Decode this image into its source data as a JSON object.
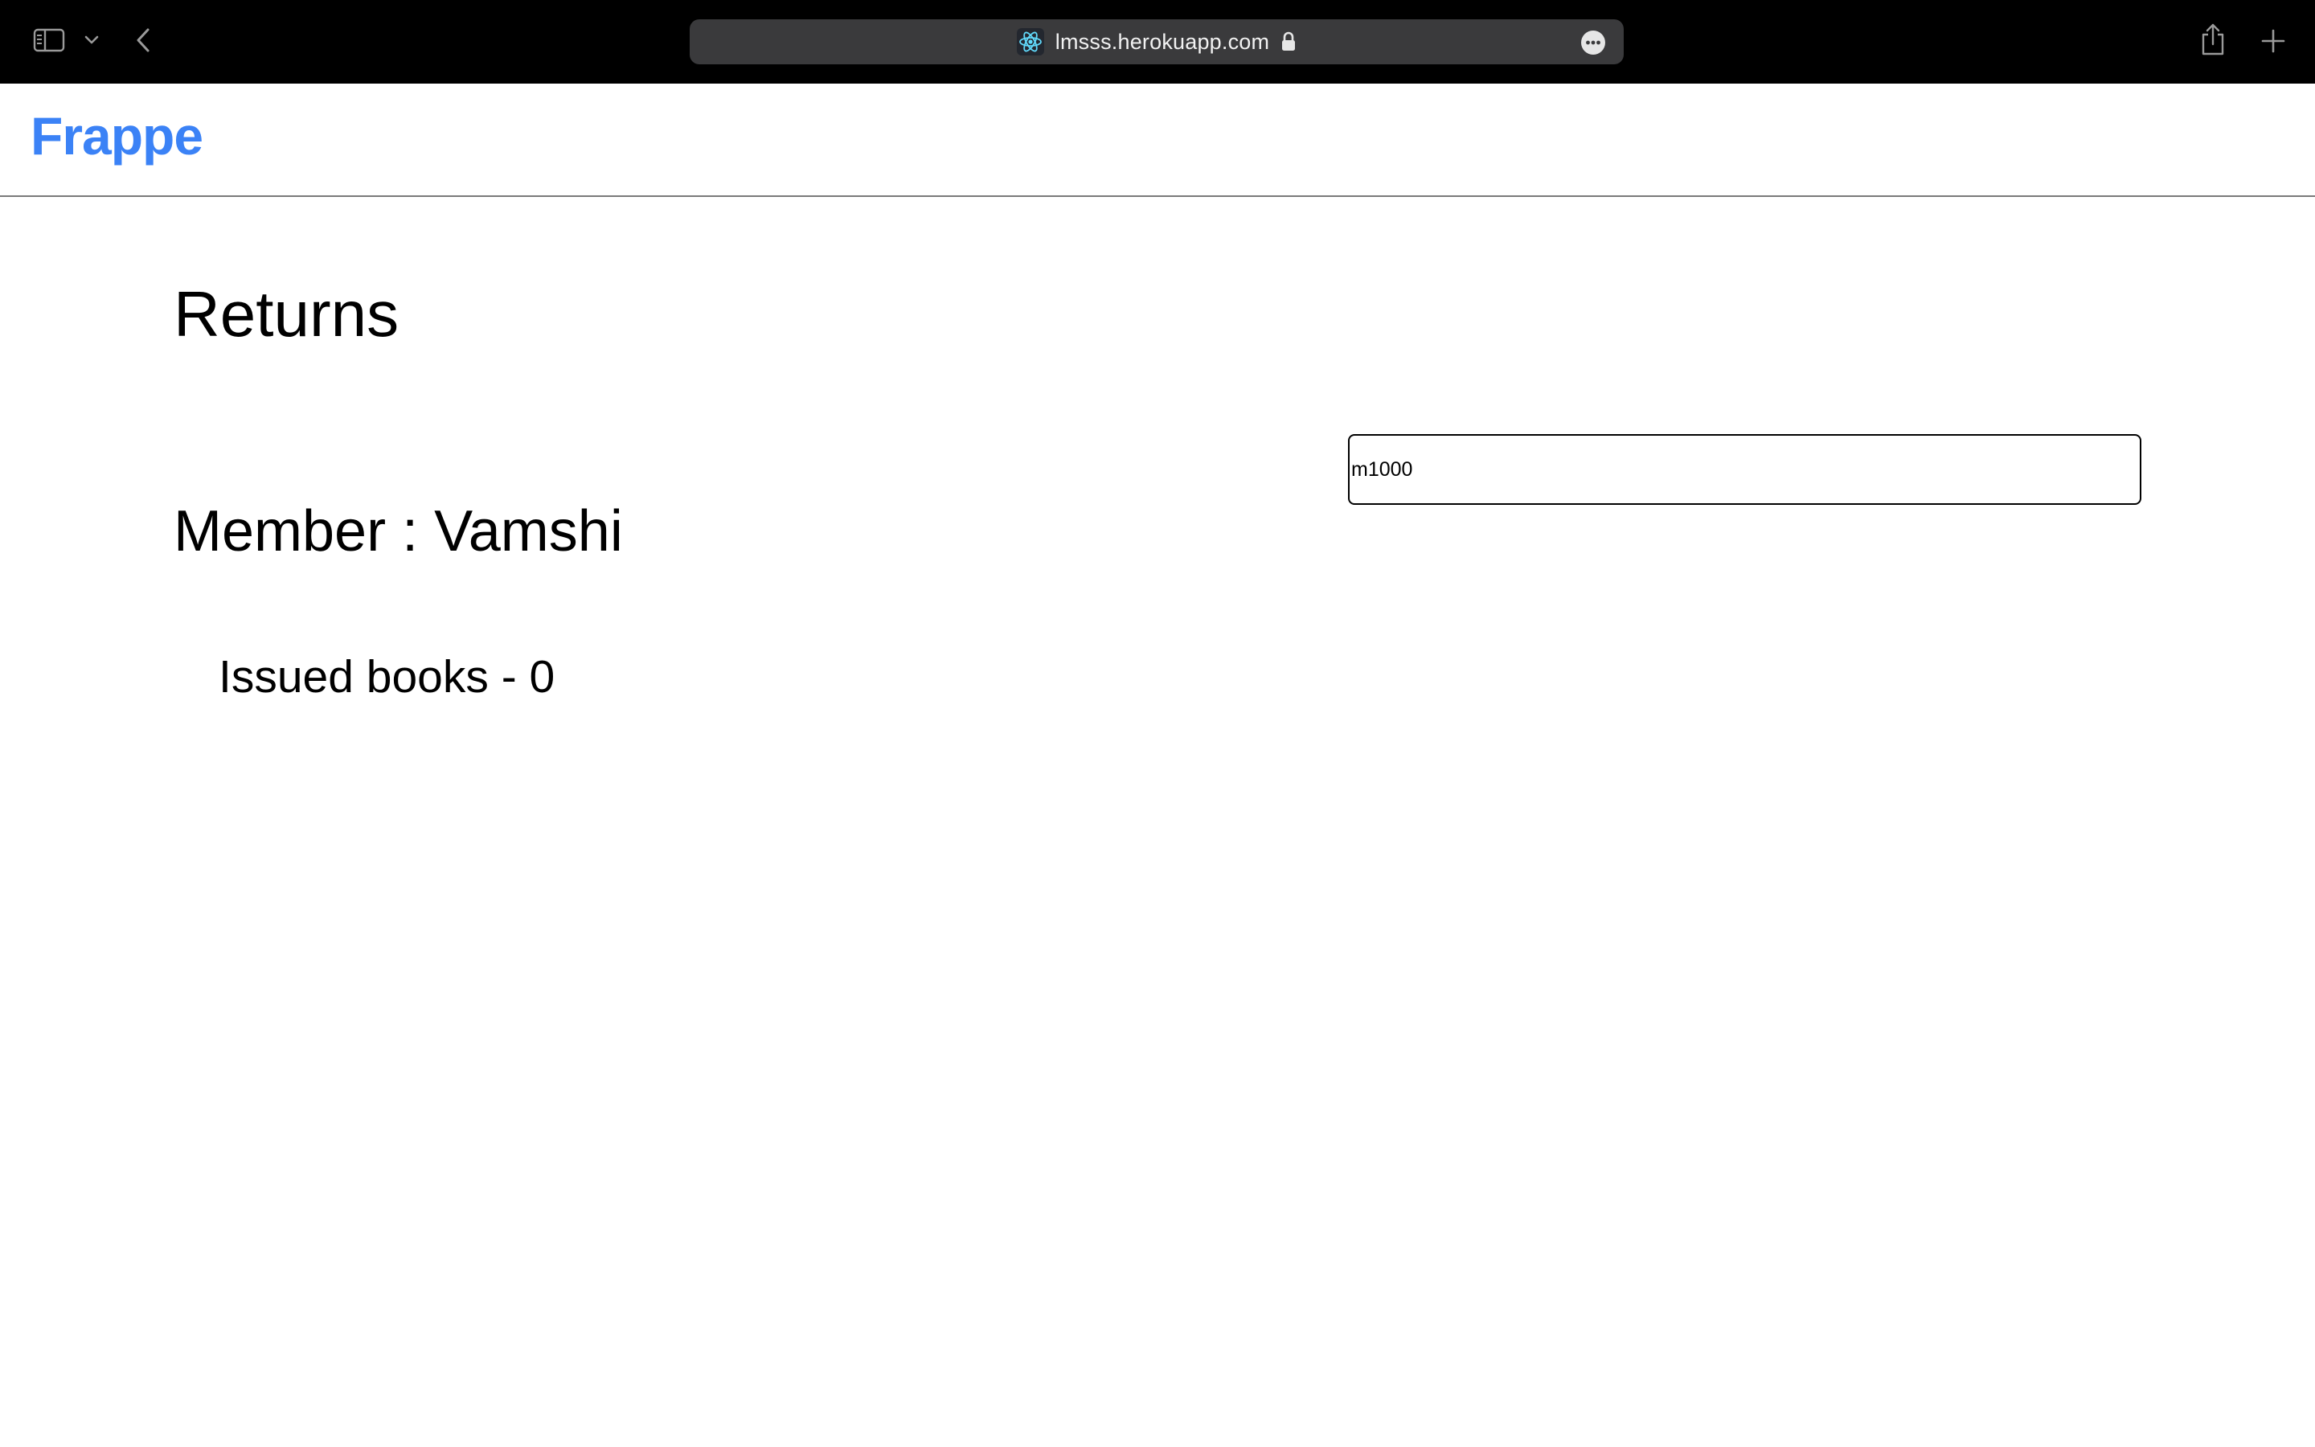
{
  "browser": {
    "url": "lmsss.herokuapp.com",
    "icons": {
      "sidebar": "sidebar-toggle-icon",
      "chevron": "chevron-down-icon",
      "back": "back-arrow-icon",
      "site": "react-atom-icon",
      "lock": "lock-icon",
      "more": "more-options-icon",
      "share": "share-icon",
      "new_tab": "plus-icon"
    }
  },
  "navbar": {
    "logo_text": "Frappe",
    "logo_color": "#3b82f6"
  },
  "main": {
    "title": "Returns",
    "member_line": "Member : Vamshi",
    "issued_books_line": "Issued books - 0",
    "member_input": {
      "value": "m1000"
    }
  }
}
